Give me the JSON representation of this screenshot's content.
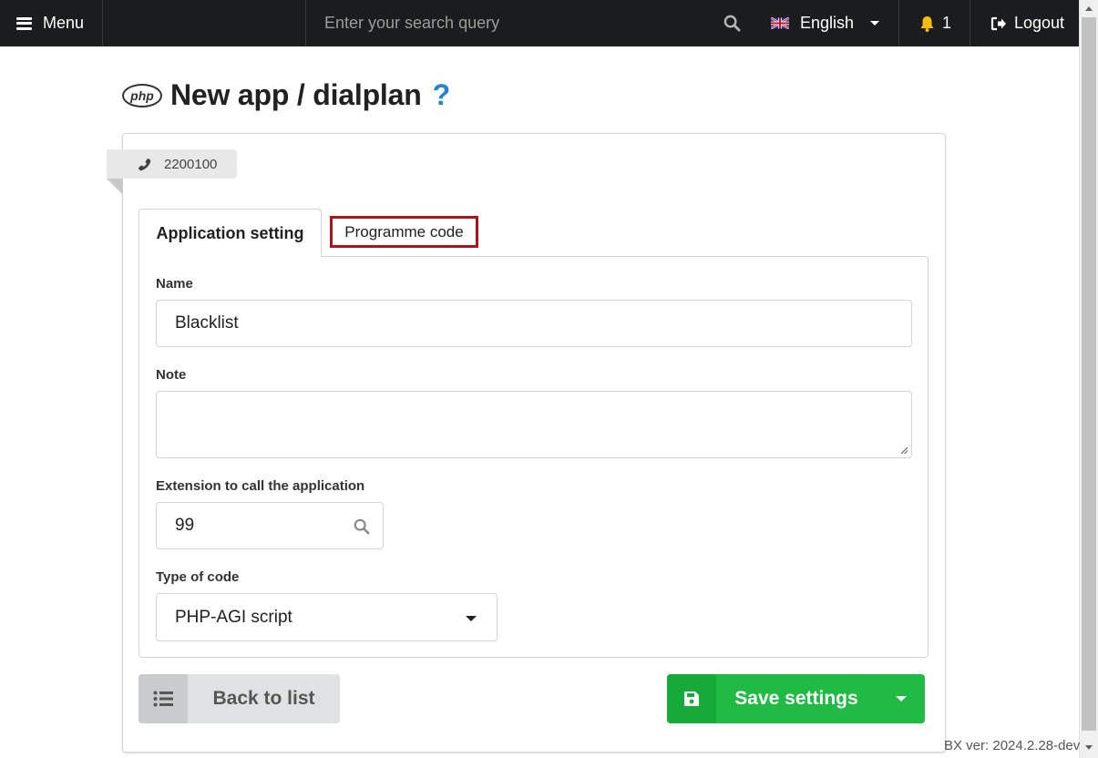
{
  "topbar": {
    "menu_label": "Menu",
    "search_placeholder": "Enter your search query",
    "language": "English",
    "notification_count": "1",
    "logout_label": "Logout"
  },
  "page": {
    "title": "New app / dialplan",
    "logo_text": "php",
    "help_glyph": "?"
  },
  "ribbon": {
    "number": "2200100"
  },
  "tabs": [
    {
      "label": "Application setting",
      "active": true
    },
    {
      "label": "Programme code",
      "active": false
    }
  ],
  "form": {
    "name_label": "Name",
    "name_value": "Blacklist",
    "note_label": "Note",
    "note_value": "",
    "extension_label": "Extension to call the application",
    "extension_value": "99",
    "code_type_label": "Type of code",
    "code_type_value": "PHP-AGI script"
  },
  "buttons": {
    "back_label": "Back to list",
    "save_label": "Save settings"
  },
  "footer": {
    "version": "BX ver: 2024.2.28-dev"
  },
  "colors": {
    "topbar_bg": "#1b1c1d",
    "save_green": "#21ba45",
    "help_blue": "#2185d0",
    "highlight_red": "#b01219",
    "bell_yellow": "#fbbd08"
  },
  "icons": {
    "menu": "hamburger-icon",
    "search": "search-icon",
    "flag": "uk-flag-icon",
    "bell": "bell-icon",
    "logout": "sign-out-icon",
    "phone": "phone-icon",
    "help": "question-icon",
    "list": "list-icon",
    "save": "floppy-disk-icon"
  }
}
